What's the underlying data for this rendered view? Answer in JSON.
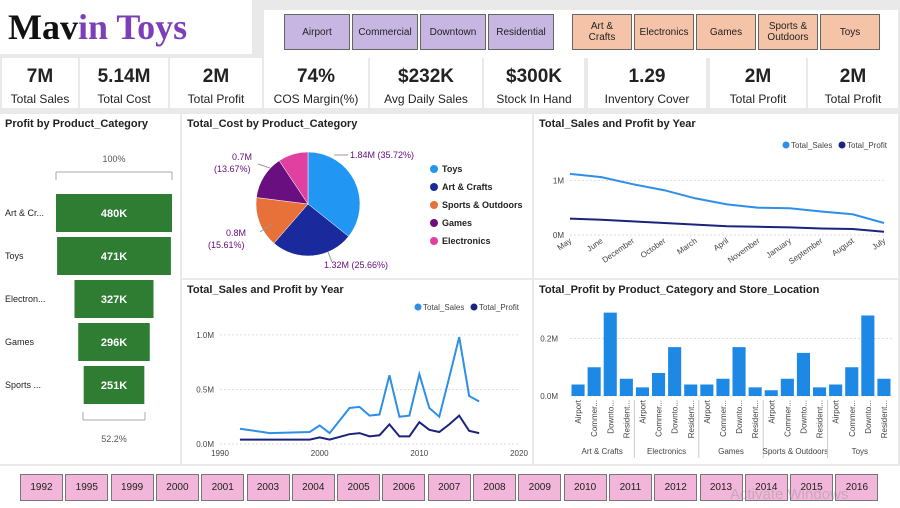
{
  "logo": {
    "part1": "Mav",
    "part2": "in Toys"
  },
  "slicers": {
    "locations": [
      "Airport",
      "Commercial",
      "Downtown",
      "Residential"
    ],
    "categories": [
      "Art & Crafts",
      "Electronics",
      "Games",
      "Sports & Outdoors",
      "Toys"
    ]
  },
  "kpis": [
    {
      "value": "7M",
      "label": "Total Sales"
    },
    {
      "value": "5.14M",
      "label": "Total Cost"
    },
    {
      "value": "2M",
      "label": "Total Profit"
    },
    {
      "value": "74%",
      "label": "COS Margin(%)"
    },
    {
      "value": "$232K",
      "label": "Avg Daily Sales"
    },
    {
      "value": "$300K",
      "label": "Stock In Hand"
    },
    {
      "value": "1.29",
      "label": "Inventory Cover"
    },
    {
      "value": "2M",
      "label": "Total Profit"
    },
    {
      "value": "2M",
      "label": "Total Profit"
    }
  ],
  "panels": {
    "funnel": "Profit by Product_Category",
    "pie": "Total_Cost by Product_Category",
    "salesMonth": "Total_Sales and Profit by Year",
    "salesYear": "Total_Sales and Profit by Year",
    "profitCat": "Total_Profit by Product_Category and Store_Location"
  },
  "colors": {
    "sales": "#2d8fe8",
    "profit": "#1a237e",
    "funnel": "#2e7d32",
    "bars": "#1e88e5"
  },
  "chart_data": [
    {
      "type": "bar",
      "title": "Profit by Product_Category",
      "categories": [
        "Art & Cr...",
        "Toys",
        "Electron...",
        "Games",
        "Sports ..."
      ],
      "values": [
        480,
        471,
        327,
        296,
        251
      ],
      "value_labels": [
        "480K",
        "471K",
        "327K",
        "296K",
        "251K"
      ],
      "top_label": "100%",
      "bottom_label": "52.2%"
    },
    {
      "type": "pie",
      "title": "Total_Cost by Product_Category",
      "legend": [
        "Toys",
        "Art & Crafts",
        "Sports & Outdoors",
        "Games",
        "Electronics"
      ],
      "values": [
        35.72,
        25.66,
        15.61,
        13.67,
        9.34
      ],
      "colors": [
        "#2196f3",
        "#1a2a9c",
        "#e8713a",
        "#6a0f80",
        "#e040a0"
      ],
      "labels": [
        "1.84M (35.72%)",
        "1.32M (25.66%)",
        "0.8M (15.61%)",
        "0.7M (13.67%)",
        ""
      ]
    },
    {
      "type": "line",
      "title": "Total_Sales and Profit by Year",
      "x": [
        "May",
        "June",
        "December",
        "October",
        "March",
        "April",
        "November",
        "January",
        "September",
        "August",
        "July"
      ],
      "series": [
        {
          "name": "Total_Sales",
          "values": [
            1.12,
            1.06,
            0.93,
            0.82,
            0.67,
            0.56,
            0.5,
            0.49,
            0.43,
            0.38,
            0.22
          ]
        },
        {
          "name": "Total_Profit",
          "values": [
            0.3,
            0.28,
            0.25,
            0.22,
            0.19,
            0.16,
            0.15,
            0.14,
            0.12,
            0.11,
            0.06
          ]
        }
      ],
      "yticks": [
        "0M",
        "1M"
      ],
      "ylim": [
        0,
        1.3
      ]
    },
    {
      "type": "line",
      "title": "Total_Sales and Profit by Year",
      "x": [
        1992,
        1995,
        1999,
        2000,
        2001,
        2003,
        2004,
        2005,
        2006,
        2007,
        2008,
        2009,
        2010,
        2011,
        2012,
        2013,
        2014,
        2015,
        2016
      ],
      "series": [
        {
          "name": "Total_Sales",
          "values": [
            0.14,
            0.1,
            0.11,
            0.17,
            0.1,
            0.33,
            0.34,
            0.26,
            0.27,
            0.63,
            0.25,
            0.26,
            0.64,
            0.33,
            0.25,
            0.61,
            0.98,
            0.44,
            0.39
          ]
        },
        {
          "name": "Total_Profit",
          "values": [
            0.04,
            0.04,
            0.04,
            0.06,
            0.04,
            0.09,
            0.1,
            0.07,
            0.08,
            0.18,
            0.07,
            0.07,
            0.2,
            0.13,
            0.11,
            0.18,
            0.26,
            0.12,
            0.1
          ]
        }
      ],
      "xticks": [
        "1990",
        "2000",
        "2010",
        "2020"
      ],
      "yticks": [
        "0.0M",
        "0.5M",
        "1.0M"
      ],
      "xlim": [
        1990,
        2020
      ],
      "ylim": [
        0,
        1.1
      ]
    },
    {
      "type": "bar",
      "title": "Total_Profit by Product_Category and Store_Location",
      "groups": [
        "Art & Crafts",
        "Electronics",
        "Games",
        "Sports & Outdoors",
        "Toys"
      ],
      "categories": [
        "Airport",
        "Commer...",
        "Downto...",
        "Resident..."
      ],
      "values": [
        [
          0.04,
          0.1,
          0.29,
          0.06
        ],
        [
          0.03,
          0.08,
          0.17,
          0.04
        ],
        [
          0.04,
          0.06,
          0.17,
          0.03
        ],
        [
          0.02,
          0.06,
          0.15,
          0.03
        ],
        [
          0.04,
          0.1,
          0.28,
          0.06
        ]
      ],
      "yticks": [
        "0.0M",
        "0.2M"
      ],
      "ylim": [
        0,
        0.32
      ]
    }
  ],
  "years": [
    "1992",
    "1995",
    "1999",
    "2000",
    "2001",
    "2003",
    "2004",
    "2005",
    "2006",
    "2007",
    "2008",
    "2009",
    "2010",
    "2011",
    "2012",
    "2013",
    "2014",
    "2015",
    "2016"
  ],
  "watermark": "Activate Windows"
}
